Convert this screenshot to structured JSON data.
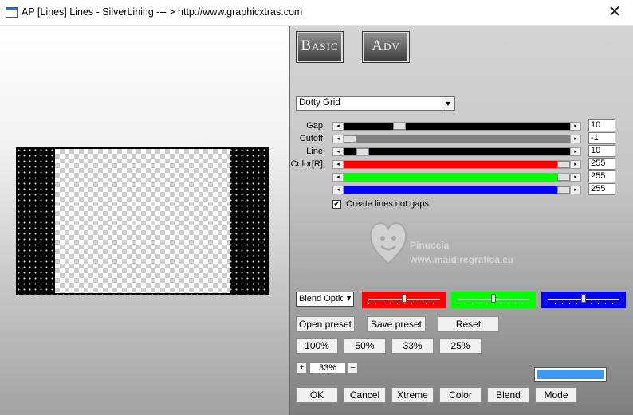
{
  "window": {
    "title": "AP [Lines]  Lines - SilverLining     --- > http://www.graphicxtras.com",
    "close_glyph": "✕"
  },
  "tabs": {
    "basic_label": "Basic",
    "adv_label": "Adv"
  },
  "preset_dropdown": {
    "value": "Dotty Grid"
  },
  "sliders": {
    "gap": {
      "label": "Gap:",
      "value": "10",
      "level": 0.23
    },
    "cutoff": {
      "label": "Cutoff:",
      "value": "-1",
      "level": 0.0
    },
    "line": {
      "label": "Line:",
      "value": "10",
      "level": 0.06
    },
    "red": {
      "label": "Color[R]:",
      "value": "255",
      "level": 1.0
    },
    "green": {
      "label": "",
      "value": "255",
      "level": 1.0
    },
    "blue": {
      "label": "",
      "value": "255",
      "level": 1.0
    }
  },
  "checkbox": {
    "label": "Create lines not gaps",
    "checked": true,
    "glyph": "✔"
  },
  "watermark": {
    "name": "Pinuccia",
    "url": "www.maidiregrafica.eu"
  },
  "blend": {
    "select_value": "Blend Optio",
    "arrow": "▼",
    "color_blocks": [
      {
        "color": "#ff0000",
        "level": 0.5
      },
      {
        "color": "#00ff00",
        "level": 0.5
      },
      {
        "color": "#0000ff",
        "level": 0.5
      }
    ]
  },
  "buttons": {
    "open_preset": "Open preset",
    "save_preset": "Save preset",
    "reset": "Reset",
    "zoom_100": "100%",
    "zoom_50": "50%",
    "zoom_33": "33%",
    "zoom_25": "25%",
    "ok": "OK",
    "cancel": "Cancel",
    "xtreme": "Xtreme",
    "color": "Color",
    "blend": "Blend",
    "mode": "Mode"
  },
  "zoom": {
    "plus": "+",
    "minus": "–",
    "value": "33%"
  },
  "swatch_color": "#3d98f0",
  "slider_colors": {
    "gap": "#000000",
    "cutoff": "#808080",
    "line": "#000000",
    "red": "#ff0000",
    "green": "#00ff00",
    "blue": "#0000ff"
  }
}
